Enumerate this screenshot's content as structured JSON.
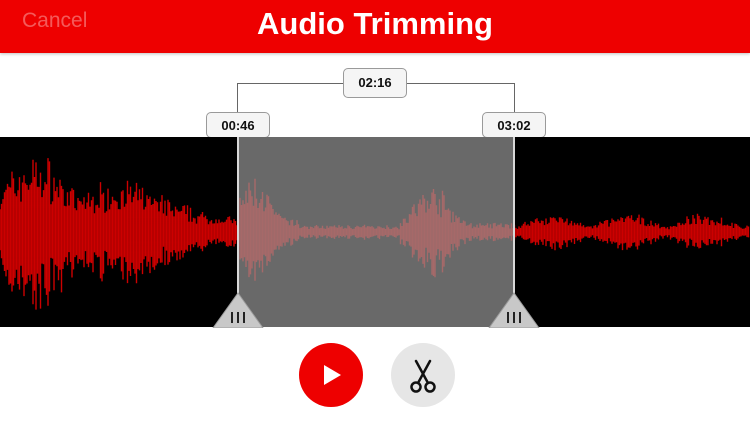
{
  "header": {
    "cancel_label": "Cancel",
    "title": "Audio Trimming"
  },
  "trim": {
    "duration": "02:16",
    "start": "00:46",
    "end": "03:02"
  },
  "colors": {
    "accent": "#ee0000",
    "waveform": "#cc0000",
    "selection": "#8c8c8c"
  },
  "controls": {
    "play_icon": "play-icon",
    "cut_icon": "scissors-icon"
  }
}
